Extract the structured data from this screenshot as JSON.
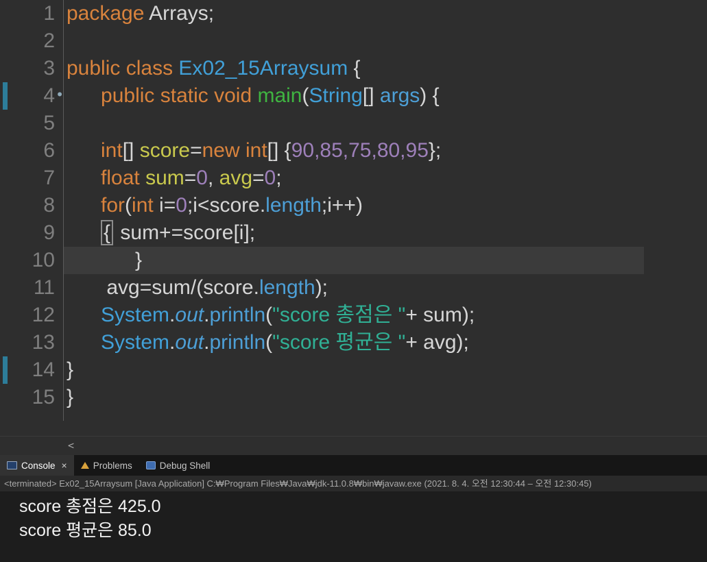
{
  "palette": {
    "keyword": "#d9833d",
    "plain": "#d6d6d6",
    "type": "#41a0d8",
    "method_decl": "#3fb441",
    "variable": "#c9c94d",
    "number": "#9e80ba",
    "string": "#30b095",
    "member": "#4d9fd6",
    "line_number": "#7f7f7f",
    "marker": "#2d7d9a"
  },
  "editor": {
    "lines": [
      {
        "num": "1",
        "segments": [
          {
            "t": "package",
            "c": "keyword"
          },
          {
            "t": " Arrays;",
            "c": "plain"
          }
        ]
      },
      {
        "num": "2",
        "segments": []
      },
      {
        "num": "3",
        "segments": [
          {
            "t": "public class ",
            "c": "keyword"
          },
          {
            "t": "Ex02_15Arraysum",
            "c": "type"
          },
          {
            "t": " {",
            "c": "plain"
          }
        ]
      },
      {
        "num": "4",
        "gutter_dot": true,
        "left_marker": true,
        "segments": [
          {
            "t": "      ",
            "c": "plain"
          },
          {
            "t": "public static void ",
            "c": "keyword"
          },
          {
            "t": "main",
            "c": "method_decl"
          },
          {
            "t": "(",
            "c": "plain"
          },
          {
            "t": "String",
            "c": "type"
          },
          {
            "t": "[] ",
            "c": "plain"
          },
          {
            "t": "args",
            "c": "member"
          },
          {
            "t": ") {",
            "c": "plain"
          }
        ]
      },
      {
        "num": "5",
        "segments": []
      },
      {
        "num": "6",
        "segments": [
          {
            "t": "      ",
            "c": "plain"
          },
          {
            "t": "int",
            "c": "keyword"
          },
          {
            "t": "[] ",
            "c": "plain"
          },
          {
            "t": "score",
            "c": "variable"
          },
          {
            "t": "=",
            "c": "plain"
          },
          {
            "t": "new int",
            "c": "keyword"
          },
          {
            "t": "[] {",
            "c": "plain"
          },
          {
            "t": "90,85,75,80,95",
            "c": "number"
          },
          {
            "t": "};",
            "c": "plain"
          }
        ]
      },
      {
        "num": "7",
        "segments": [
          {
            "t": "      ",
            "c": "plain"
          },
          {
            "t": "float ",
            "c": "keyword"
          },
          {
            "t": "sum",
            "c": "variable"
          },
          {
            "t": "=",
            "c": "plain"
          },
          {
            "t": "0",
            "c": "number"
          },
          {
            "t": ", ",
            "c": "plain"
          },
          {
            "t": "avg",
            "c": "variable"
          },
          {
            "t": "=",
            "c": "plain"
          },
          {
            "t": "0",
            "c": "number"
          },
          {
            "t": ";",
            "c": "plain"
          }
        ]
      },
      {
        "num": "8",
        "segments": [
          {
            "t": "      ",
            "c": "plain"
          },
          {
            "t": "for",
            "c": "keyword"
          },
          {
            "t": "(",
            "c": "plain"
          },
          {
            "t": "int",
            "c": "keyword"
          },
          {
            "t": " i=",
            "c": "plain"
          },
          {
            "t": "0",
            "c": "number"
          },
          {
            "t": ";i<score.",
            "c": "plain"
          },
          {
            "t": "length",
            "c": "member"
          },
          {
            "t": ";i++)",
            "c": "plain"
          }
        ]
      },
      {
        "num": "9",
        "segments": [
          {
            "t": "      ",
            "c": "plain"
          },
          {
            "t": "{",
            "c": "plain",
            "box": true
          },
          {
            "t": " sum+=score[i];",
            "c": "plain"
          }
        ]
      },
      {
        "num": "10",
        "highlight": true,
        "segments": [
          {
            "t": "            }",
            "c": "plain"
          }
        ]
      },
      {
        "num": "11",
        "segments": [
          {
            "t": "       avg=sum/(score.",
            "c": "plain"
          },
          {
            "t": "length",
            "c": "member"
          },
          {
            "t": ");",
            "c": "plain"
          }
        ]
      },
      {
        "num": "12",
        "segments": [
          {
            "t": "      ",
            "c": "plain"
          },
          {
            "t": "System",
            "c": "type"
          },
          {
            "t": ".",
            "c": "plain"
          },
          {
            "t": "out",
            "c": "member",
            "i": true
          },
          {
            "t": ".",
            "c": "plain"
          },
          {
            "t": "println",
            "c": "member"
          },
          {
            "t": "(",
            "c": "plain"
          },
          {
            "t": "\"score 총점은 \"",
            "c": "string"
          },
          {
            "t": "+ sum);",
            "c": "plain"
          }
        ]
      },
      {
        "num": "13",
        "segments": [
          {
            "t": "      ",
            "c": "plain"
          },
          {
            "t": "System",
            "c": "type"
          },
          {
            "t": ".",
            "c": "plain"
          },
          {
            "t": "out",
            "c": "member",
            "i": true
          },
          {
            "t": ".",
            "c": "plain"
          },
          {
            "t": "println",
            "c": "member"
          },
          {
            "t": "(",
            "c": "plain"
          },
          {
            "t": "\"score 평균은 \"",
            "c": "string"
          },
          {
            "t": "+ avg);",
            "c": "plain"
          }
        ]
      },
      {
        "num": "14",
        "left_marker": true,
        "segments": [
          {
            "t": "}",
            "c": "plain"
          }
        ]
      },
      {
        "num": "15",
        "segments": [
          {
            "t": "}",
            "c": "plain"
          }
        ]
      }
    ]
  },
  "scrollbar": {
    "left_arrow": "<"
  },
  "console": {
    "tabs": [
      {
        "label": "Console",
        "active": true
      },
      {
        "label": "Problems",
        "active": false
      },
      {
        "label": "Debug Shell",
        "active": false
      }
    ],
    "close_glyph": "×",
    "status_line": "<terminated> Ex02_15Arraysum [Java Application] C:₩Program Files₩Java₩jdk-11.0.8₩bin₩javaw.exe  (2021. 8. 4. 오전 12:30:44 – 오전 12:30:45)",
    "output": [
      "score 총점은 425.0",
      "score 평균은 85.0"
    ]
  }
}
